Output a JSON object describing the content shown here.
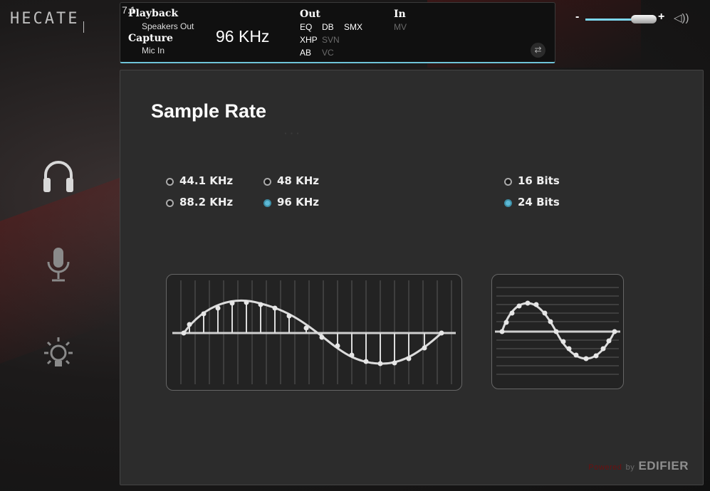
{
  "app": {
    "logo": "HECATE"
  },
  "topbar": {
    "channel": "7.1",
    "playback_label": "Playback",
    "playback_device": "Speakers Out",
    "capture_label": "Capture",
    "capture_device": "Mic In",
    "rate_display": "96  KHz",
    "out_label": "Out",
    "in_label": "In",
    "out_tags": [
      "EQ",
      "DB",
      "SMX",
      "XHP",
      "SVN",
      "AB",
      "VC"
    ],
    "in_tags": [
      "MV"
    ]
  },
  "volume": {
    "minus": "-",
    "plus": "+",
    "level_fraction": 0.62
  },
  "panel": {
    "title": "Sample Rate",
    "rates": [
      "44.1 KHz",
      "48 KHz",
      "88.2 KHz",
      "96 KHz"
    ],
    "selected_rate": "96 KHz",
    "bits": [
      "16 Bits",
      "24 Bits"
    ],
    "selected_bits": "24 Bits",
    "brand_powered": "Powered",
    "brand_by": "by",
    "brand_name": "EDIFIER"
  },
  "colors": {
    "accent": "#5db9d6",
    "panel": "#2c2c2c",
    "brand_red": "#6a1010"
  },
  "icons": [
    "headphones-icon",
    "microphone-icon",
    "light-bulb-icon",
    "swap-arrows-icon",
    "speaker-icon"
  ]
}
